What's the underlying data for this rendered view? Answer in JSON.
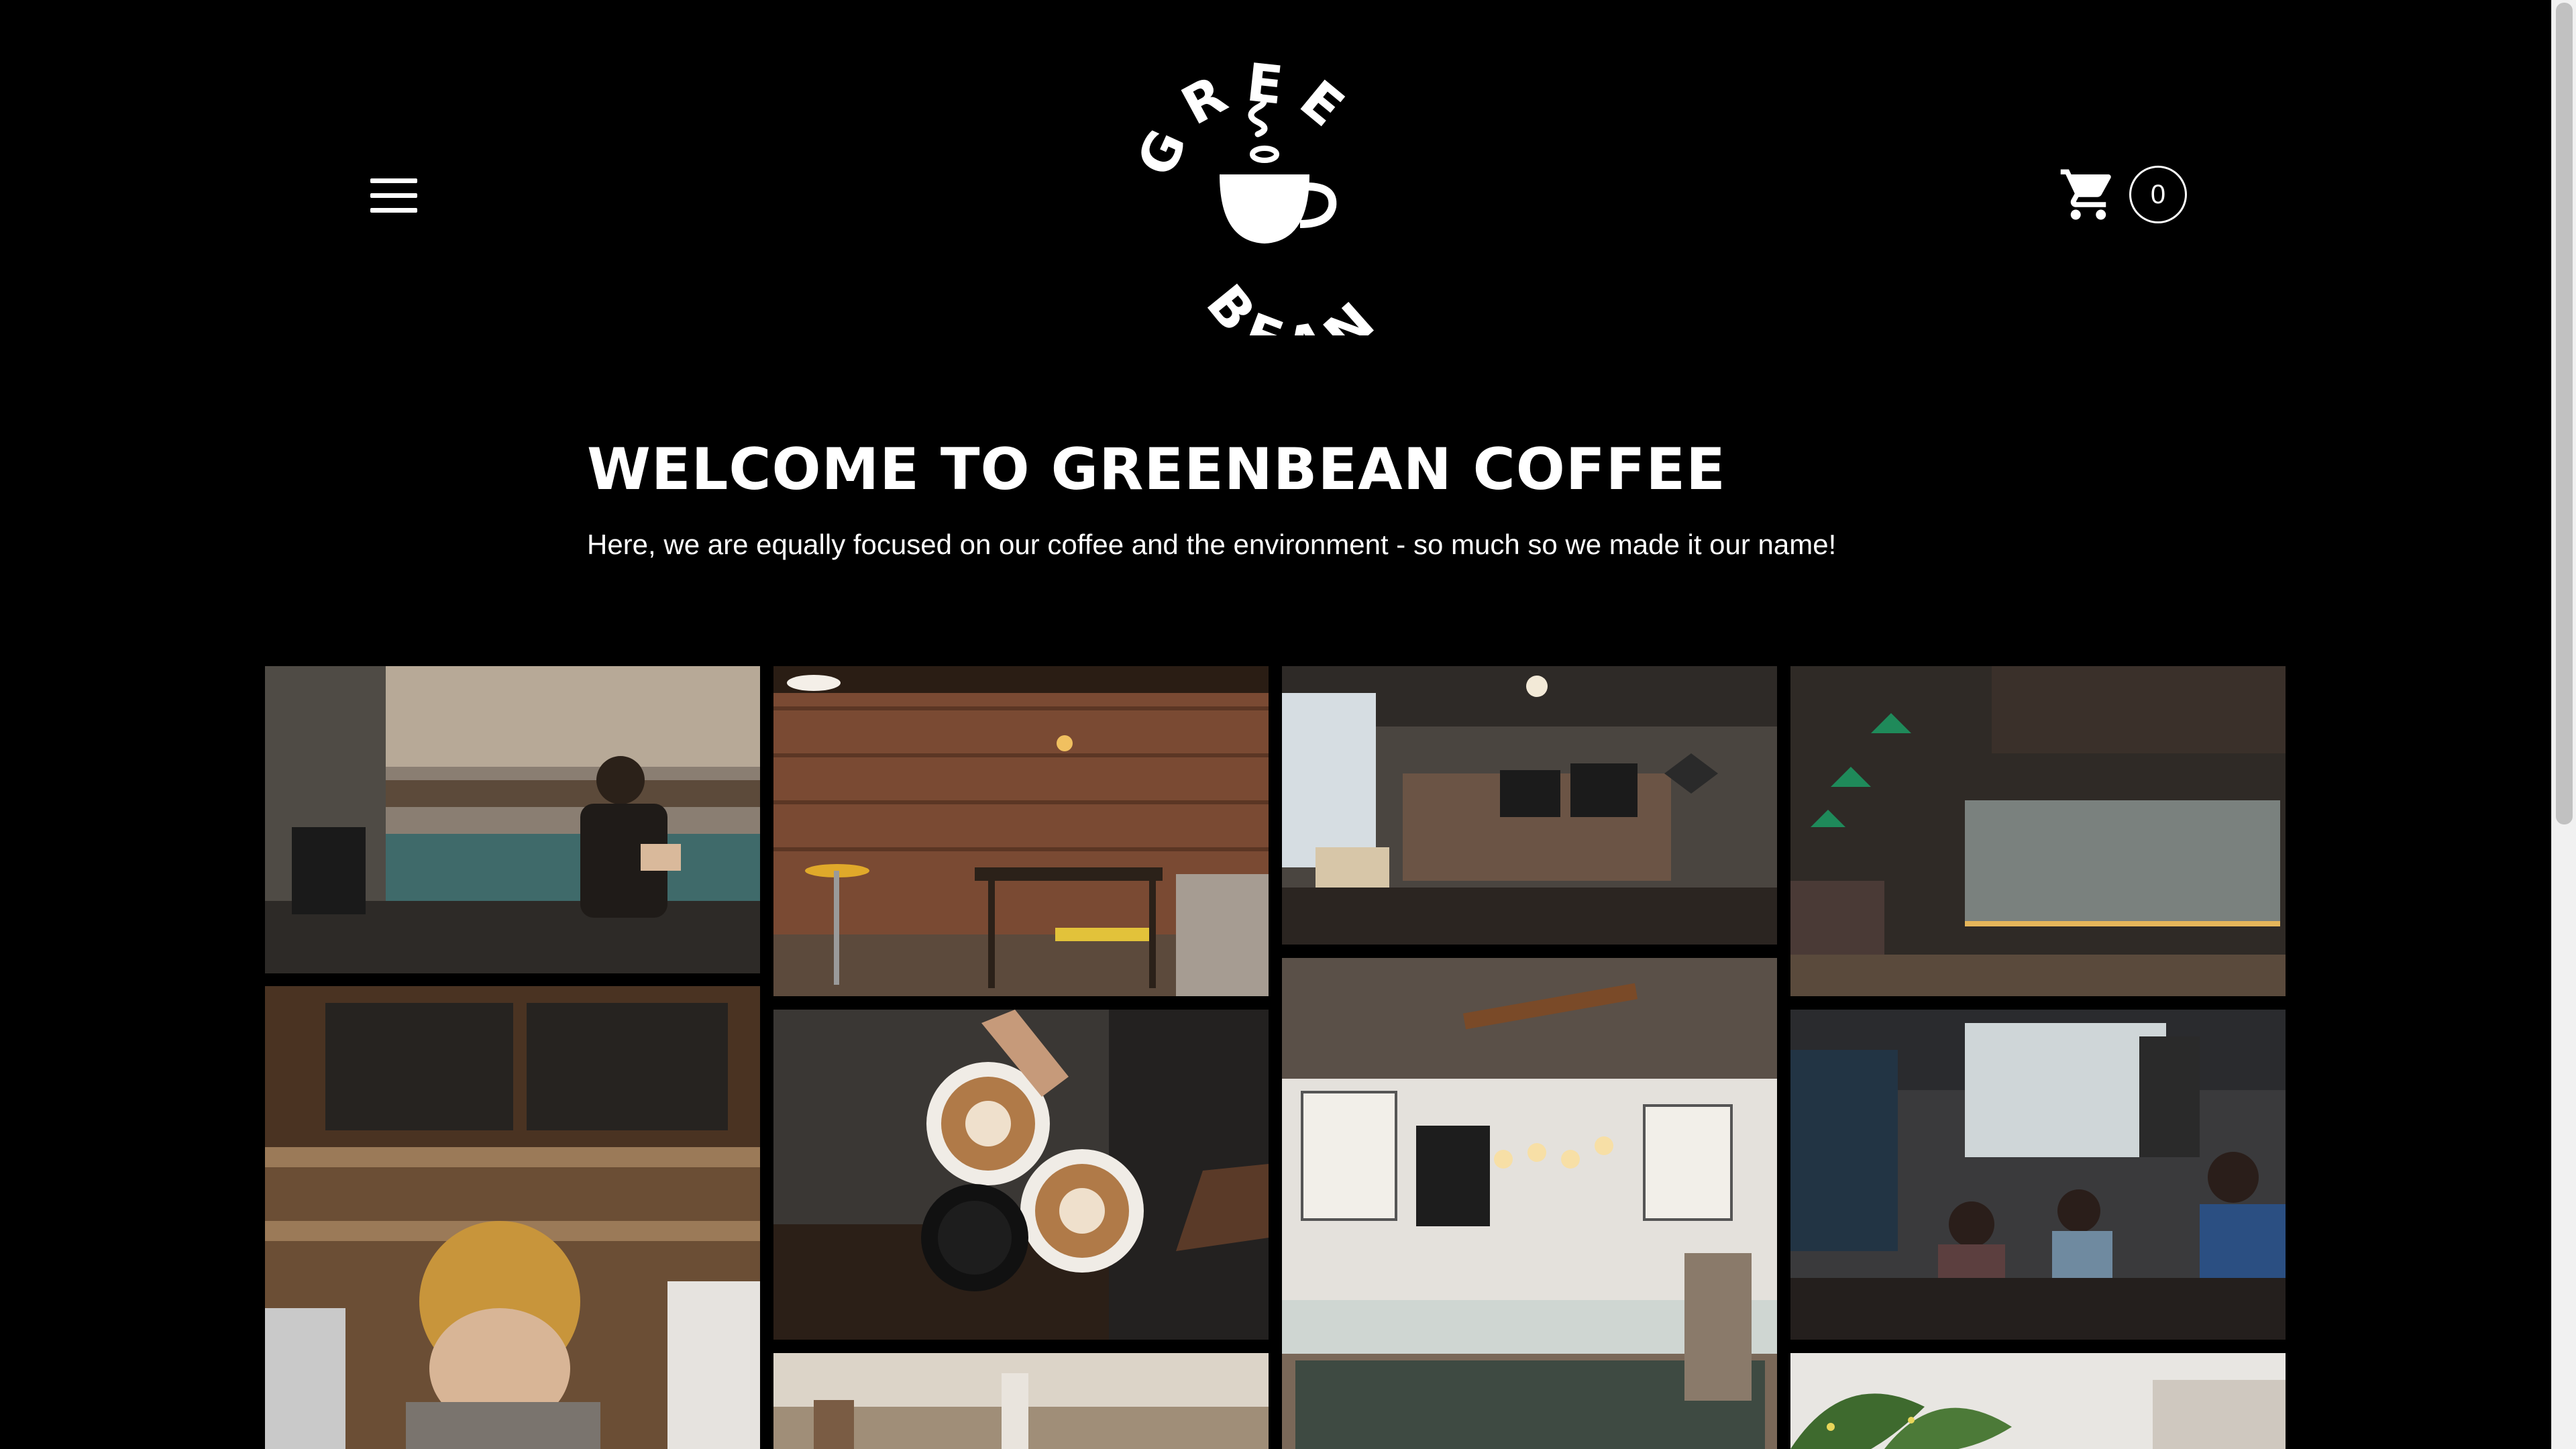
{
  "header": {
    "menu_icon": "hamburger-menu-icon",
    "logo_icon": "greenbean-coffee-cup-logo",
    "logo_text_top": "GREEN",
    "logo_text_bottom": "BEAN",
    "cart_icon": "shopping-cart-icon",
    "cart_count": "0"
  },
  "welcome": {
    "title": "WELCOME TO GREENBEAN COFFEE",
    "subtitle": "Here, we are equally focused on our coffee and the environment - so much so we made it our name!"
  },
  "gallery": {
    "images": [
      {
        "subject": "barista pouring milk at coffee bar"
      },
      {
        "subject": "brick wall cafe interior with stools"
      },
      {
        "subject": "cafe counter with chalkboard menus"
      },
      {
        "subject": "cafe with neon CAFE sign and green lamps"
      },
      {
        "subject": "woman in yellow beanie at espresso machine"
      },
      {
        "subject": "hands toasting latte art cups"
      },
      {
        "subject": "bakery counter with hanging bulbs"
      },
      {
        "subject": "busy cafe with people seated"
      },
      {
        "subject": "blurred cafe interior"
      },
      {
        "subject": "green plant leaves closeup"
      }
    ]
  },
  "colors": {
    "background": "#000000",
    "text": "#ffffff"
  }
}
